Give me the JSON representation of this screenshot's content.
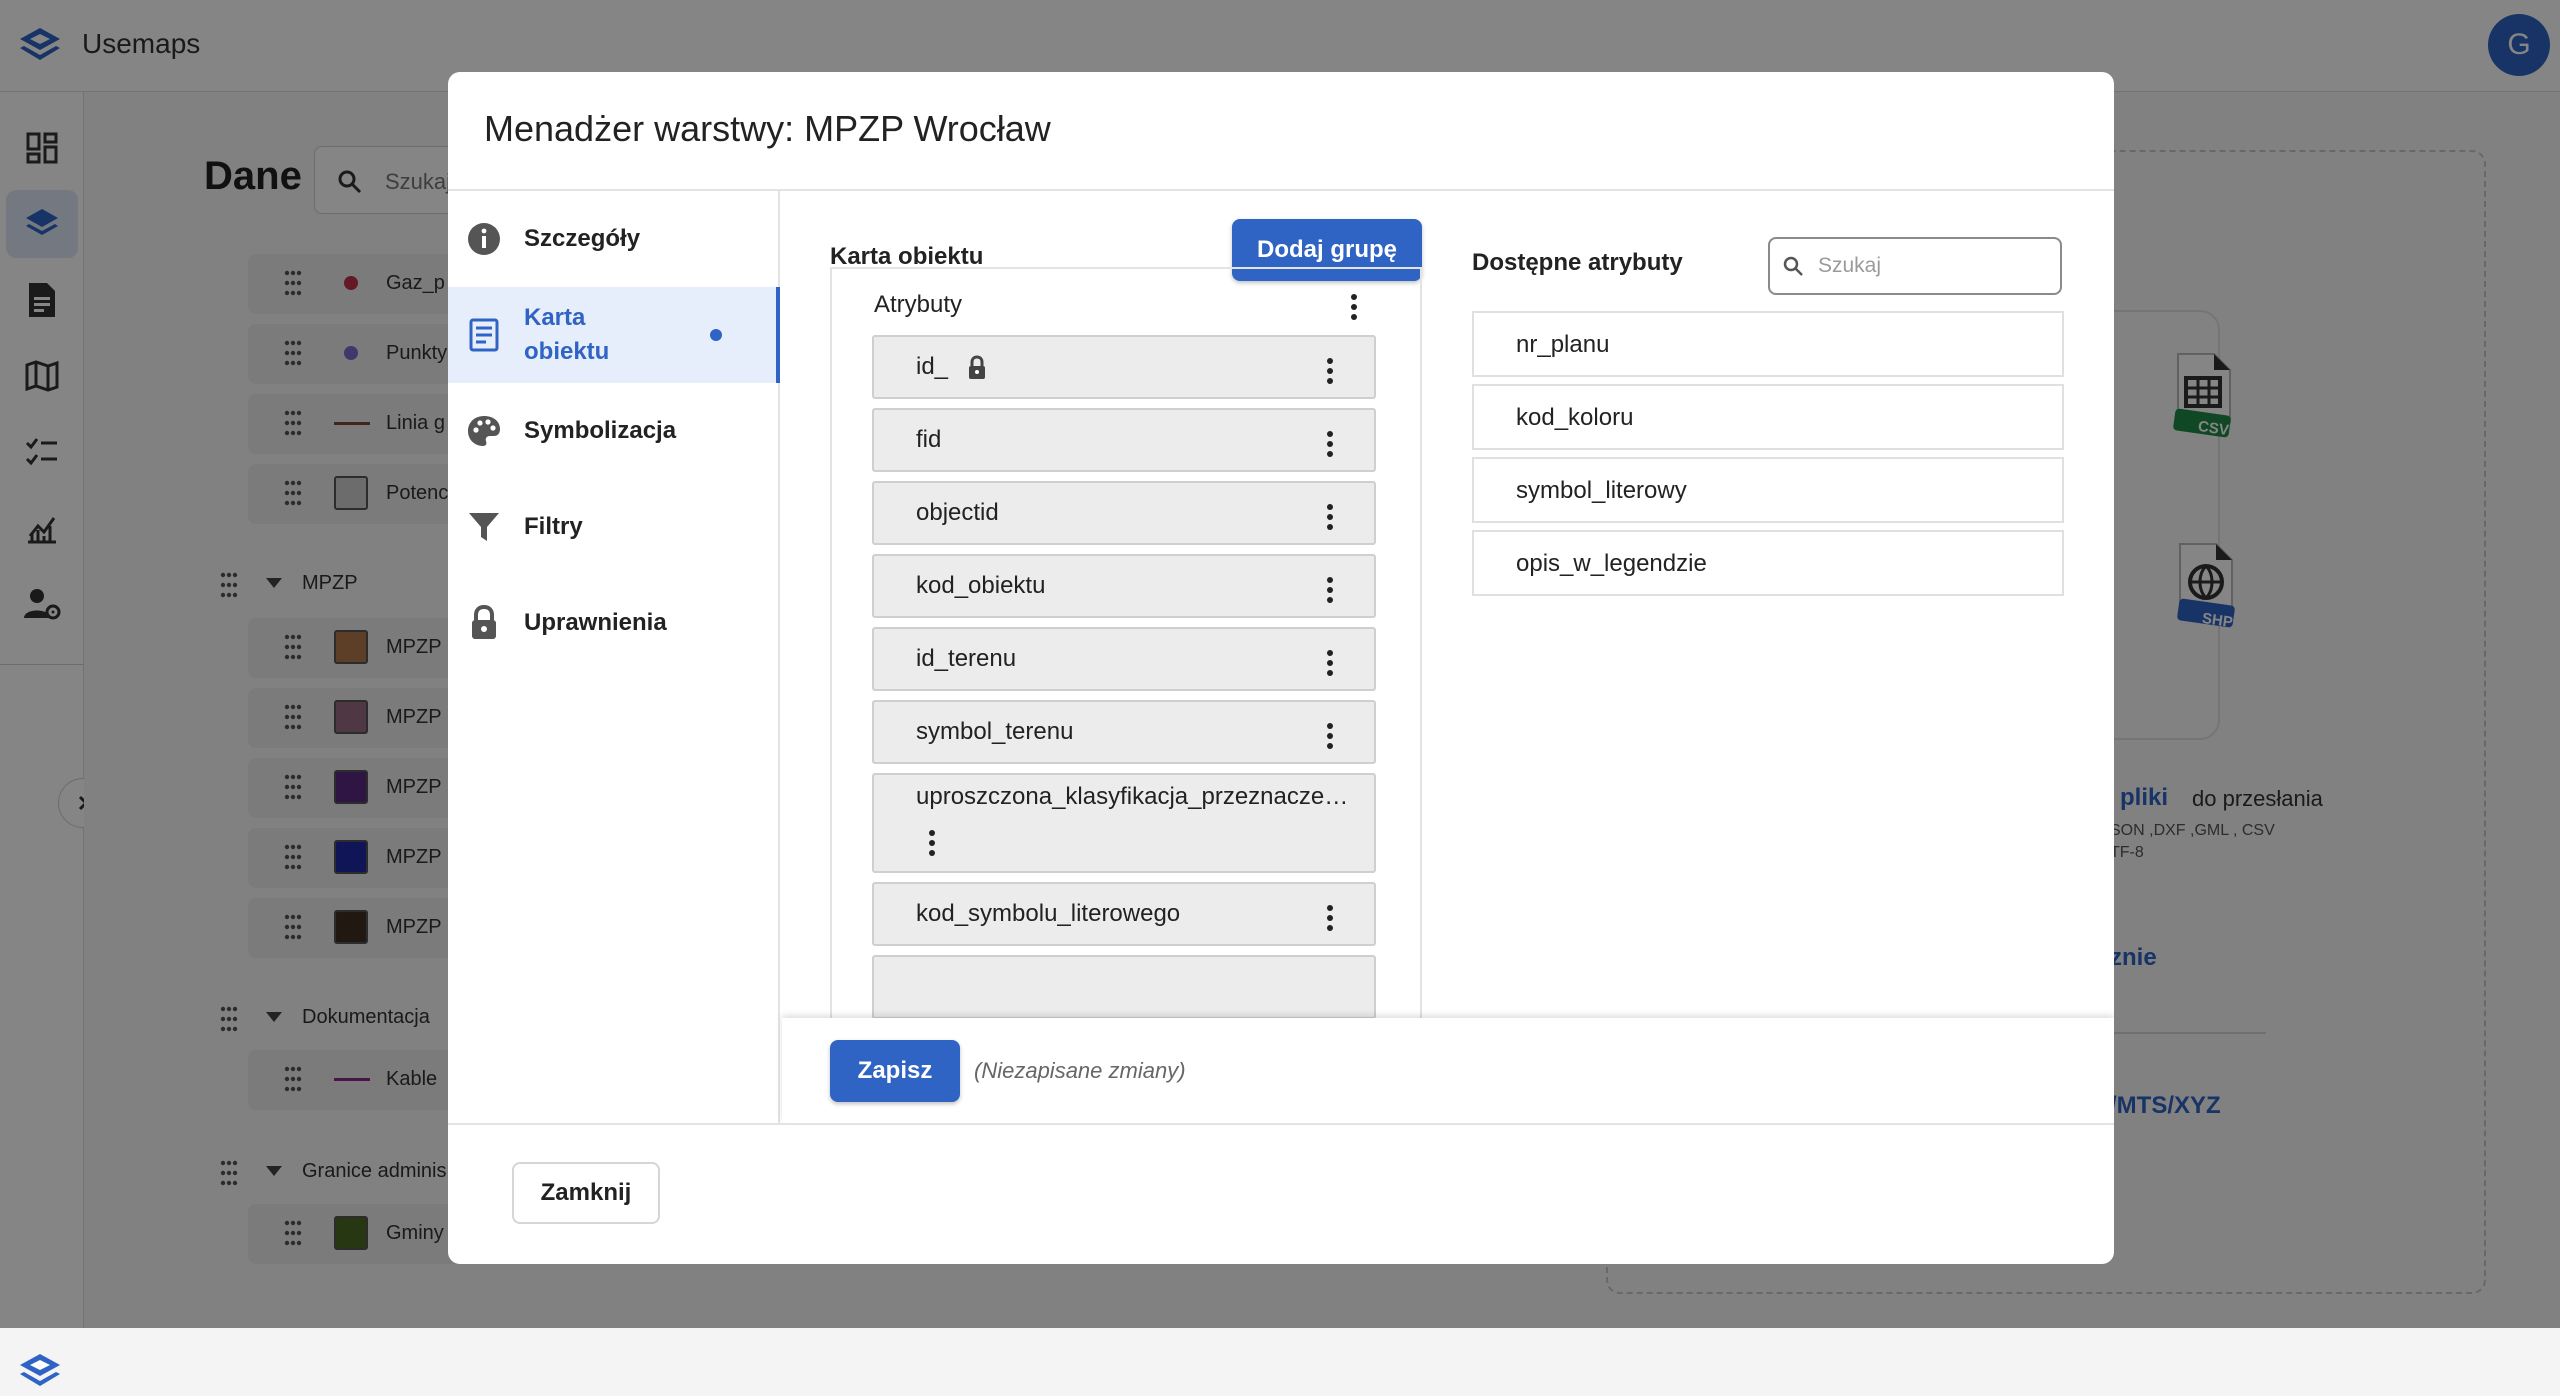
{
  "app": {
    "title": "Usemaps",
    "user_initial": "G",
    "accent": "#2f63c4"
  },
  "nav": {
    "icons": [
      "dashboard-icon",
      "layers-icon",
      "document-icon",
      "map-icon",
      "checklist-icon",
      "analytics-icon",
      "user-settings-icon"
    ],
    "active": "layers-icon"
  },
  "page": {
    "title": "Dane",
    "search_placeholder": "Szukaj",
    "layers_top": [
      {
        "label": "Gaz_p",
        "style": "dot",
        "color": "#c0304a"
      },
      {
        "label": "Punkty",
        "style": "dot",
        "color": "#7a6bd1"
      },
      {
        "label": "Linia g",
        "style": "line",
        "color": "#7a4a3a"
      },
      {
        "label": "Potenc",
        "style": "square",
        "color": "#cfcfcf"
      }
    ],
    "group_mpzp": {
      "label": "MPZP",
      "layers": [
        {
          "label": "MPZP",
          "color": "#b07a4a"
        },
        {
          "label": "MPZP",
          "color": "#9a6a82"
        },
        {
          "label": "MPZP",
          "color": "#5a2a82"
        },
        {
          "label": "MPZP",
          "color": "#1f2aa8"
        },
        {
          "label": "MPZP",
          "color": "#3e2e22"
        }
      ]
    },
    "group_doc": {
      "label": "Dokumentacja",
      "layers": [
        {
          "label": "Kable",
          "style": "line",
          "color": "#8a2a8a"
        }
      ]
    },
    "group_admin": {
      "label": "Granice adminis",
      "layers": [
        {
          "label": "Gminy",
          "color": "#4a6a22"
        }
      ]
    },
    "upload": {
      "csv_badge": "CSV",
      "shp_badge": "SHP",
      "link_files": "pliki",
      "text_upload": "do przesłania",
      "formats": "SON ,DXF ,GML , CSV",
      "encoding": "TF-8",
      "link_manual": "znie",
      "link_services": "/MTS/XYZ"
    }
  },
  "modal": {
    "title": "Menadżer warstwy: MPZP Wrocław",
    "tabs": [
      {
        "label": "Szczegóły",
        "icon": "info-icon"
      },
      {
        "label": "Karta obiektu",
        "icon": "card-icon",
        "active": true,
        "dirty": true
      },
      {
        "label": "Symbolizacja",
        "icon": "palette-icon"
      },
      {
        "label": "Filtry",
        "icon": "filter-icon"
      },
      {
        "label": "Uprawnienia",
        "icon": "lock-icon"
      }
    ],
    "card": {
      "title": "Karta obiektu",
      "add_group": "Dodaj grupę",
      "group_name": "Atrybuty",
      "attributes": [
        {
          "name": "id_",
          "locked": true
        },
        {
          "name": "fid"
        },
        {
          "name": "objectid"
        },
        {
          "name": "kod_obiektu"
        },
        {
          "name": "id_terenu"
        },
        {
          "name": "symbol_terenu"
        },
        {
          "name": "uproszczona_klasyfikacja_przeznacze…"
        },
        {
          "name": "kod_symbolu_literowego"
        }
      ]
    },
    "available": {
      "title": "Dostępne atrybuty",
      "search_placeholder": "Szukaj",
      "items": [
        "nr_planu",
        "kod_koloru",
        "symbol_literowy",
        "opis_w_legendzie"
      ]
    },
    "save_label": "Zapisz",
    "unsaved_note": "(Niezapisane zmiany)",
    "close_label": "Zamknij"
  }
}
